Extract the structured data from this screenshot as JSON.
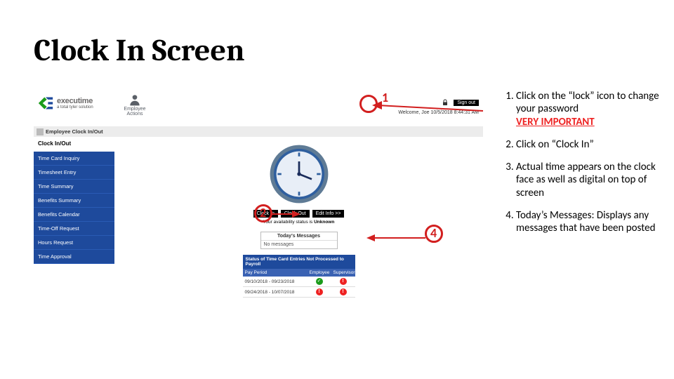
{
  "slide": {
    "title": "Clock In Screen"
  },
  "header": {
    "logo_text": "executime",
    "logo_tagline": "a total tyler solution",
    "employee_actions_l1": "Employee",
    "employee_actions_l2": "Actions",
    "signout": "Sign out",
    "welcome": "Welcome, Joe 10/5/2018 8:44:31 AM"
  },
  "crumb": {
    "label": "Employee Clock In/Out"
  },
  "sidebar": {
    "heading": "Clock In/Out",
    "items": [
      "Time Card Inquiry",
      "Timesheet Entry",
      "Time Summary",
      "Benefits Summary",
      "Benefits Calendar",
      "Time-Off Request",
      "Hours Request",
      "Time Approval"
    ]
  },
  "clock": {
    "clock_in": "Clock In",
    "clock_out": "Clock Out",
    "edit_info": "Edit Info >>",
    "availability_prefix": "Your availability status is ",
    "availability_status": "Unknown"
  },
  "messages": {
    "heading": "Today's Messages",
    "empty": "No messages"
  },
  "status": {
    "caption": "Status of Time Card Entries Not Processed to Payroll",
    "col_pp": "Pay Period",
    "col_emp": "Employee",
    "col_sup": "Supervisor",
    "rows": [
      {
        "period": "09/10/2018 - 09/23/2018",
        "emp": "ok",
        "sup": "warn"
      },
      {
        "period": "09/24/2018 - 10/07/2018",
        "emp": "warn",
        "sup": "warn"
      }
    ]
  },
  "callouts": {
    "n1": "1",
    "n2": "2",
    "n4": "4"
  },
  "instructions": {
    "i1a": "Click on the “lock” icon to change your password",
    "i1b": "VERY IMPORTANT",
    "i2": "Click on “Clock In”",
    "i3": "Actual time appears on the clock face as well as digital on top of screen",
    "i4": "Today’s Messages: Displays any messages that have been posted"
  }
}
